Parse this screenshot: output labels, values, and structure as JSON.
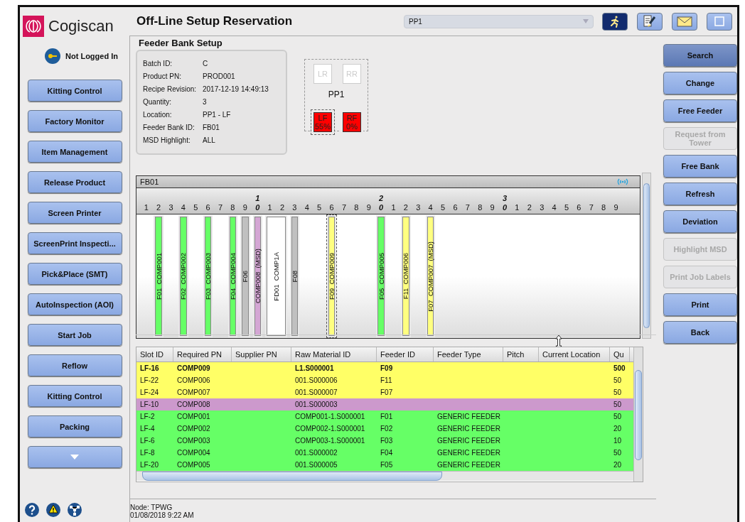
{
  "header": {
    "logo": "Cogiscan",
    "title": "Off-Line Setup Reservation",
    "machine_select": {
      "value": "PP1"
    }
  },
  "login": {
    "status": "Not Logged In"
  },
  "nav": [
    {
      "label": "Kitting Control",
      "kind": "text"
    },
    {
      "label": "Factory Monitor",
      "kind": "text"
    },
    {
      "label": "Item Management",
      "kind": "text"
    },
    {
      "label": "Release Product",
      "kind": "text"
    },
    {
      "label": "Screen Printer",
      "kind": "text"
    },
    {
      "label": "ScreenPrint Inspecti...",
      "kind": "text"
    },
    {
      "label": "Pick&Place (SMT)",
      "kind": "text"
    },
    {
      "label": "AutoInspection (AOI)",
      "kind": "text"
    },
    {
      "label": "Start Job",
      "kind": "text"
    },
    {
      "label": "Reflow",
      "kind": "text"
    },
    {
      "label": "Kitting Control",
      "kind": "text"
    },
    {
      "label": "Packing",
      "kind": "text"
    },
    {
      "kind": "more"
    }
  ],
  "section_title": "Feeder Bank Setup",
  "info": [
    {
      "label": "Batch ID:",
      "value": "C"
    },
    {
      "label": "Product PN:",
      "value": "PROD001"
    },
    {
      "label": "Recipe Revision:",
      "value": "2017-12-19 14:49:13"
    },
    {
      "label": "Quantity:",
      "value": "3"
    },
    {
      "label": "Location:",
      "value": "PP1 - LF"
    },
    {
      "label": "Feeder Bank ID:",
      "value": "FB01"
    },
    {
      "label": "MSD Highlight:",
      "value": "ALL"
    }
  ],
  "machine": {
    "name": "PP1",
    "banks": [
      {
        "label": "LR",
        "active": false,
        "selected": false
      },
      {
        "label": "RR",
        "active": false,
        "selected": false
      },
      {
        "label": "LF",
        "percent": "55%",
        "active": true,
        "selected": true
      },
      {
        "label": "RF",
        "percent": "0%",
        "active": true,
        "selected": false
      }
    ]
  },
  "feeder_bank": {
    "title": "FB01",
    "ruler": [
      {
        "unit": "1"
      },
      {
        "unit": "2",
        "feeder": {
          "label": "F01  COMP001",
          "color": "#66ff66",
          "selected": false,
          "wide": false
        }
      },
      {
        "unit": "3"
      },
      {
        "unit": "4",
        "feeder": {
          "label": "F02  COMP002",
          "color": "#66ff66",
          "selected": false,
          "wide": false
        }
      },
      {
        "unit": "5"
      },
      {
        "unit": "6",
        "feeder": {
          "label": "F03  COMP003",
          "color": "#66ff66",
          "selected": false,
          "wide": false
        }
      },
      {
        "unit": "7"
      },
      {
        "unit": "8",
        "feeder": {
          "label": "F04  COMP004",
          "color": "#66ff66",
          "selected": false,
          "wide": false
        }
      },
      {
        "unit": "9",
        "feeder": {
          "label": "F06",
          "color": "#c0c0c0",
          "selected": false,
          "wide": false
        }
      },
      {
        "tens": "1",
        "unit": "0",
        "feeder": {
          "label": "COMP008  (MSD)",
          "color": "#d4a6d4",
          "selected": false,
          "wide": false
        }
      },
      {
        "unit": "1",
        "feeder": {
          "label": "FD01  COMP1A",
          "color": "#ffffff",
          "selected": false,
          "wide": true
        }
      },
      {
        "unit": "2"
      },
      {
        "unit": "3",
        "feeder": {
          "label": "F08",
          "color": "#c0c0c0",
          "selected": false,
          "wide": false
        }
      },
      {
        "unit": "4"
      },
      {
        "unit": "5"
      },
      {
        "unit": "6",
        "feeder": {
          "label": "F09  COMP009",
          "color": "#ffff80",
          "selected": true,
          "wide": false
        }
      },
      {
        "unit": "7"
      },
      {
        "unit": "8"
      },
      {
        "unit": "9"
      },
      {
        "tens": "2",
        "unit": "0",
        "feeder": {
          "label": "F05  COMP005",
          "color": "#66ff66",
          "selected": false,
          "wide": false
        }
      },
      {
        "unit": "1"
      },
      {
        "unit": "2",
        "feeder": {
          "label": "F11  COMP006",
          "color": "#ffff80",
          "selected": false,
          "wide": false
        }
      },
      {
        "unit": "3"
      },
      {
        "unit": "4",
        "feeder": {
          "label": "F07  COMP007  (MSD)",
          "color": "#ffff80",
          "selected": false,
          "wide": false
        }
      },
      {
        "unit": "5"
      },
      {
        "unit": "6"
      },
      {
        "unit": "7"
      },
      {
        "unit": "8"
      },
      {
        "unit": "9"
      },
      {
        "tens": "3",
        "unit": "0"
      },
      {
        "unit": "1"
      },
      {
        "unit": "2"
      },
      {
        "unit": "3"
      },
      {
        "unit": "4"
      },
      {
        "unit": "5"
      },
      {
        "unit": "6"
      },
      {
        "unit": "7"
      },
      {
        "unit": "8"
      },
      {
        "unit": "9"
      }
    ]
  },
  "table": {
    "columns": [
      "Slot ID",
      "Required PN",
      "Supplier PN",
      "Raw Material ID",
      "Feeder ID",
      "Feeder Type",
      "Pitch",
      "Current Location",
      "Qu"
    ],
    "rows": [
      {
        "color": "#ffff66",
        "selected": true,
        "cells": [
          "LF-16",
          "COMP009",
          "",
          "L1.S000001",
          "F09",
          "",
          "",
          "",
          "500"
        ]
      },
      {
        "color": "#ffff66",
        "selected": false,
        "cells": [
          "LF-22",
          "COMP006",
          "",
          "001.S000006",
          "F11",
          "",
          "",
          "",
          "50"
        ]
      },
      {
        "color": "#ffff66",
        "selected": false,
        "cells": [
          "LF-24",
          "COMP007",
          "",
          "001.S000007",
          "F07",
          "",
          "",
          "",
          "50"
        ]
      },
      {
        "color": "#cc99cc",
        "selected": false,
        "cells": [
          "LF-10",
          "COMP008",
          "",
          "001.S000003",
          "",
          "",
          "",
          "",
          "50"
        ]
      },
      {
        "color": "#66ff66",
        "selected": false,
        "cells": [
          "LF-2",
          "COMP001",
          "",
          "COMP001-1.S000001",
          "F01",
          "GENERIC FEEDER",
          "",
          "",
          "50"
        ]
      },
      {
        "color": "#66ff66",
        "selected": false,
        "cells": [
          "LF-4",
          "COMP002",
          "",
          "COMP002-1.S000001",
          "F02",
          "GENERIC FEEDER",
          "",
          "",
          "20"
        ]
      },
      {
        "color": "#66ff66",
        "selected": false,
        "cells": [
          "LF-6",
          "COMP003",
          "",
          "COMP003-1.S000001",
          "F03",
          "GENERIC FEEDER",
          "",
          "",
          "10"
        ]
      },
      {
        "color": "#66ff66",
        "selected": false,
        "cells": [
          "LF-8",
          "COMP004",
          "",
          "001.S000002",
          "F04",
          "GENERIC FEEDER",
          "",
          "",
          "50"
        ]
      },
      {
        "color": "#66ff66",
        "selected": false,
        "cells": [
          "LF-20",
          "COMP005",
          "",
          "001.S000005",
          "F05",
          "GENERIC FEEDER",
          "",
          "",
          "20"
        ]
      }
    ]
  },
  "actions": [
    {
      "label": "Search",
      "disabled": false,
      "selected": true
    },
    {
      "label": "Change",
      "disabled": false,
      "selected": false
    },
    {
      "label": "Free Feeder",
      "disabled": false,
      "selected": false
    },
    {
      "label": "Request from Tower",
      "disabled": true,
      "selected": false
    },
    {
      "label": "Free Bank",
      "disabled": false,
      "selected": false
    },
    {
      "label": "Refresh",
      "disabled": false,
      "selected": false
    },
    {
      "label": "Deviation",
      "disabled": false,
      "selected": false
    },
    {
      "label": "Highlight MSD",
      "disabled": true,
      "selected": false
    },
    {
      "label": "Print Job Labels",
      "disabled": true,
      "selected": false
    },
    {
      "label": "Print",
      "disabled": false,
      "selected": false
    },
    {
      "label": "Back",
      "disabled": false,
      "selected": false
    }
  ],
  "status_bar": {
    "node": "Node: TPWG",
    "datetime": "01/08/2018 9:22 AM"
  }
}
